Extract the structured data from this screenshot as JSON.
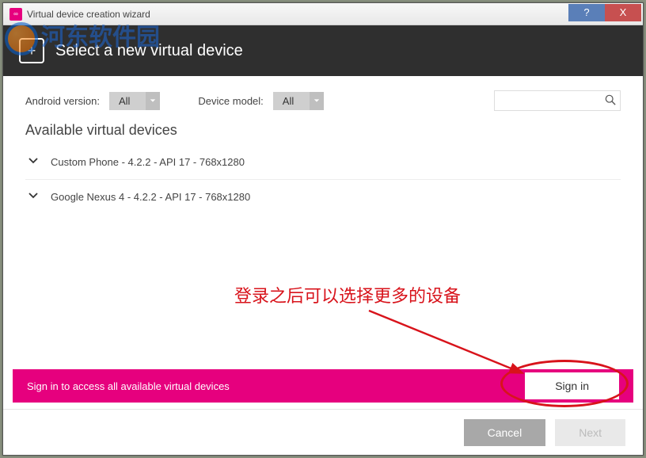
{
  "titlebar": {
    "title": "Virtual device creation wizard",
    "help_label": "?",
    "close_label": "X"
  },
  "header": {
    "title": "Select a new virtual device"
  },
  "filters": {
    "android_label": "Android version:",
    "android_value": "All",
    "model_label": "Device model:",
    "model_value": "All",
    "search_placeholder": ""
  },
  "section_title": "Available virtual devices",
  "devices": [
    {
      "label": "Custom Phone - 4.2.2 - API 17 - 768x1280"
    },
    {
      "label": "Google Nexus 4 - 4.2.2 - API 17 - 768x1280"
    }
  ],
  "signin_bar": {
    "text": "Sign in to access all available virtual devices",
    "button": "Sign in"
  },
  "buttons": {
    "cancel": "Cancel",
    "next": "Next"
  },
  "watermark": "河东软件园",
  "annotation": "登录之后可以选择更多的设备"
}
